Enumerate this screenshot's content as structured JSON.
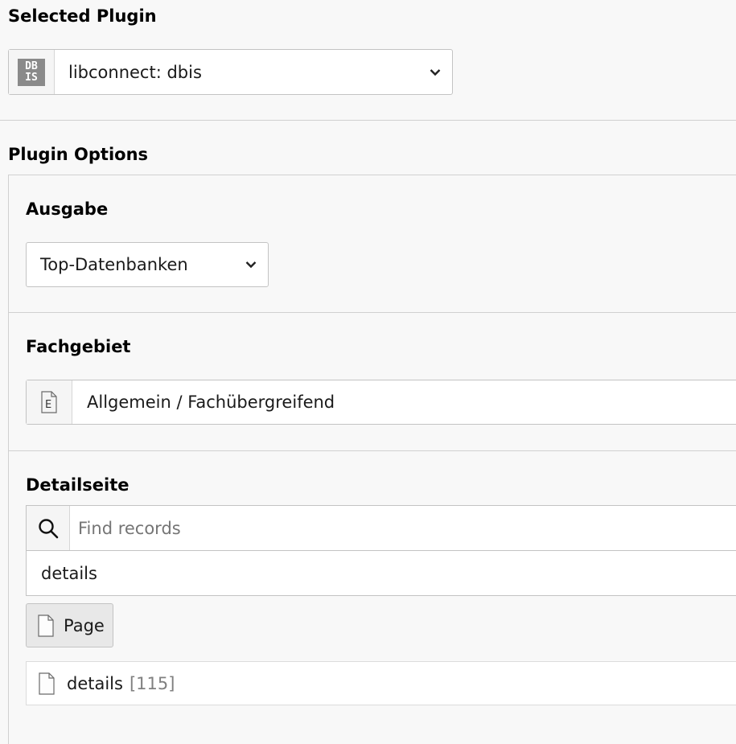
{
  "selected_plugin": {
    "heading": "Selected Plugin",
    "value": "libconnect: dbis",
    "icon_text_top": "DB",
    "icon_text_bottom": "IS"
  },
  "plugin_options": {
    "heading": "Plugin Options",
    "ausgabe": {
      "label": "Ausgabe",
      "value": "Top-Datenbanken"
    },
    "fachgebiet": {
      "label": "Fachgebiet",
      "value": "Allgemein / Fachübergreifend"
    },
    "detailseite": {
      "label": "Detailseite",
      "search_placeholder": "Find records",
      "search_value": "details",
      "page_button_label": "Page",
      "record_title": "details",
      "record_id": "[115]"
    }
  }
}
